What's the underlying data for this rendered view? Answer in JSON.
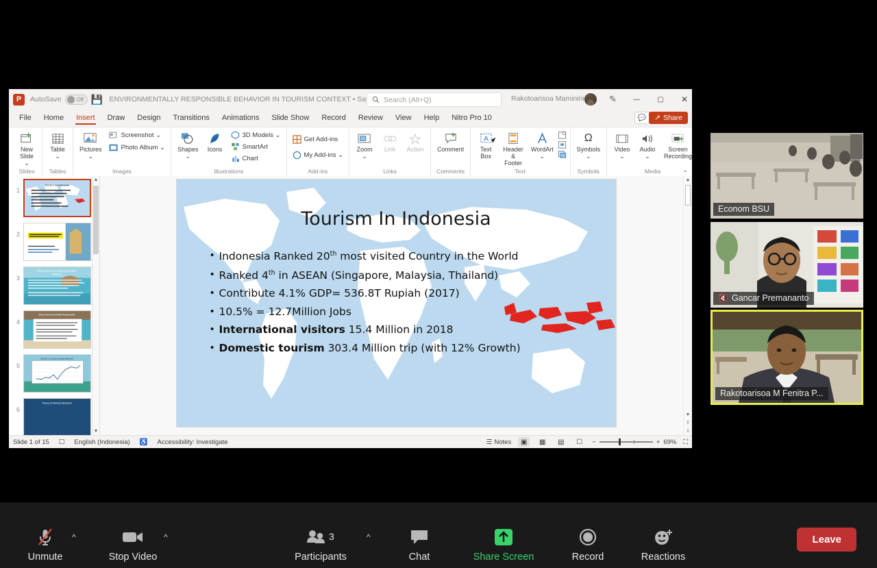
{
  "powerpoint": {
    "titlebar": {
      "app_icon": "powerpoint-logo",
      "autosave_label": "AutoSave",
      "autosave_state": "Off",
      "save_icon": "save-icon",
      "document_title": "ENVIRONMENTALLY RESPONSIBLE BEHAVIOR IN TOURISM CONTEXT • Saved to this PC",
      "title_chevron": "⌄",
      "search_placeholder": "Search (Alt+Q)",
      "user_name": "Rakotoarisoa Maminirina",
      "pen_icon": "pen-icon",
      "minimize": "—",
      "maximize": "▢",
      "close": "✕"
    },
    "tabs": [
      {
        "label": "File",
        "active": false
      },
      {
        "label": "Home",
        "active": false
      },
      {
        "label": "Insert",
        "active": true
      },
      {
        "label": "Draw",
        "active": false
      },
      {
        "label": "Design",
        "active": false
      },
      {
        "label": "Transitions",
        "active": false
      },
      {
        "label": "Animations",
        "active": false
      },
      {
        "label": "Slide Show",
        "active": false
      },
      {
        "label": "Record",
        "active": false
      },
      {
        "label": "Review",
        "active": false
      },
      {
        "label": "View",
        "active": false
      },
      {
        "label": "Help",
        "active": false
      },
      {
        "label": "Nitro Pro 10",
        "active": false
      }
    ],
    "comment_button": "comment-icon",
    "share_button": "Share",
    "ribbon_groups": [
      {
        "label": "Slides",
        "buttons": [
          {
            "caption": "New\nSlide ⌄",
            "icon": "new-slide-icon"
          }
        ]
      },
      {
        "label": "Tables",
        "buttons": [
          {
            "caption": "Table\n⌄",
            "icon": "table-icon"
          }
        ]
      },
      {
        "label": "Images",
        "buttons": [
          {
            "caption": "Pictures\n⌄",
            "icon": "pictures-icon"
          },
          {
            "caption": "Screenshot ⌄",
            "icon": "screenshot-icon"
          },
          {
            "caption": "Photo Album   ⌄",
            "icon": "photo-album-icon"
          }
        ]
      },
      {
        "label": "Illustrations",
        "buttons": [
          {
            "caption": "Shapes\n⌄",
            "icon": "shapes-icon"
          },
          {
            "caption": "Icons",
            "icon": "icons-icon"
          },
          {
            "caption": "3D Models   ⌄",
            "icon": "3d-models-icon"
          },
          {
            "caption": "SmartArt",
            "icon": "smartart-icon"
          },
          {
            "caption": "Chart",
            "icon": "chart-icon"
          }
        ]
      },
      {
        "label": "Add-ins",
        "buttons": [
          {
            "caption": "Get Add-ins",
            "icon": "get-addins-icon"
          },
          {
            "caption": "My Add-ins  ⌄",
            "icon": "my-addins-icon"
          }
        ]
      },
      {
        "label": "Links",
        "buttons": [
          {
            "caption": "Zoom\n⌄",
            "icon": "zoom-icon"
          },
          {
            "caption": "Link",
            "icon": "link-icon",
            "disabled": true
          },
          {
            "caption": "Action",
            "icon": "action-icon",
            "disabled": true
          }
        ]
      },
      {
        "label": "Comments",
        "buttons": [
          {
            "caption": "Comment",
            "icon": "comment-icon"
          }
        ]
      },
      {
        "label": "Text",
        "buttons": [
          {
            "caption": "Text\nBox",
            "icon": "text-box-icon"
          },
          {
            "caption": "Header\n& Footer",
            "icon": "header-footer-icon"
          },
          {
            "caption": "WordArt\n⌄",
            "icon": "wordart-icon"
          }
        ]
      },
      {
        "label": "Symbols",
        "buttons": [
          {
            "caption": "Symbols\n⌄",
            "icon": "symbols-icon"
          }
        ]
      },
      {
        "label": "Media",
        "buttons": [
          {
            "caption": "Video\n⌄",
            "icon": "video-icon"
          },
          {
            "caption": "Audio\n⌄",
            "icon": "audio-icon"
          },
          {
            "caption": "Screen\nRecording",
            "icon": "screen-recording-icon"
          }
        ]
      }
    ],
    "ribbon_collapse": "⌄",
    "thumbnails": [
      {
        "number": "1",
        "selected": true
      },
      {
        "number": "2",
        "selected": false
      },
      {
        "number": "3",
        "selected": false
      },
      {
        "number": "4",
        "selected": false
      },
      {
        "number": "5",
        "selected": false
      },
      {
        "number": "6",
        "selected": false
      }
    ],
    "slide": {
      "title": "Tourism In Indonesia",
      "bullets": [
        {
          "html": "Indonesia Ranked 20<sup>th</sup> most visited Country in the World"
        },
        {
          "html": "Ranked 4<sup>th</sup> in ASEAN (Singapore, Malaysia, Thailand)"
        },
        {
          "html": "Contribute  4.1% GDP= 536.8T Rupiah (2017)"
        },
        {
          "html": "10.5% = 12.7Million Jobs"
        },
        {
          "html": "<b>International visitors</b> 15.4 Million in 2018"
        },
        {
          "html": "<b>Domestic tourism</b> 303.4 Million trip (with 12% Growth)"
        }
      ],
      "highlight_color": "#e0261f",
      "ocean_color": "#bcd9ef",
      "land_color": "#ffffff"
    },
    "status_bar": {
      "slide_counter": "Slide 1 of 15",
      "language": "English (Indonesia)",
      "accessibility": "Accessibility: Investigate",
      "notes_label": "Notes",
      "view_buttons": [
        "normal-view",
        "slide-sorter-view",
        "reading-view",
        "slide-show-view"
      ],
      "zoom_minus": "−",
      "zoom_plus": "+",
      "zoom_level": "69%",
      "fit_icon": "fit-to-window-icon"
    }
  },
  "zoom_meeting": {
    "participants_video": [
      {
        "name": "Econom BSU",
        "muted": false,
        "active_speaker": false
      },
      {
        "name": "Gancar Premananto",
        "muted": true,
        "active_speaker": false
      },
      {
        "name": "Rakotoarisoa M Fenitra P...",
        "muted": false,
        "active_speaker": true
      }
    ],
    "toolbar": [
      {
        "label": "Unmute",
        "icon": "microphone-muted-icon",
        "has_chevron": true,
        "highlight": false
      },
      {
        "label": "Stop Video",
        "icon": "video-camera-icon",
        "has_chevron": true,
        "highlight": false
      },
      {
        "label": "Participants",
        "icon": "participants-icon",
        "count": "3",
        "has_chevron": true,
        "highlight": false
      },
      {
        "label": "Chat",
        "icon": "chat-bubble-icon",
        "has_chevron": false,
        "highlight": false
      },
      {
        "label": "Share Screen",
        "icon": "share-screen-icon",
        "has_chevron": false,
        "highlight": true
      },
      {
        "label": "Record",
        "icon": "record-icon",
        "has_chevron": false,
        "highlight": false
      },
      {
        "label": "Reactions",
        "icon": "reactions-icon",
        "has_chevron": false,
        "highlight": false
      }
    ],
    "leave_button": "Leave",
    "accent_green": "#3ad26a",
    "leave_red": "#bf3232",
    "active_speaker_border": "#e8ef4b"
  }
}
